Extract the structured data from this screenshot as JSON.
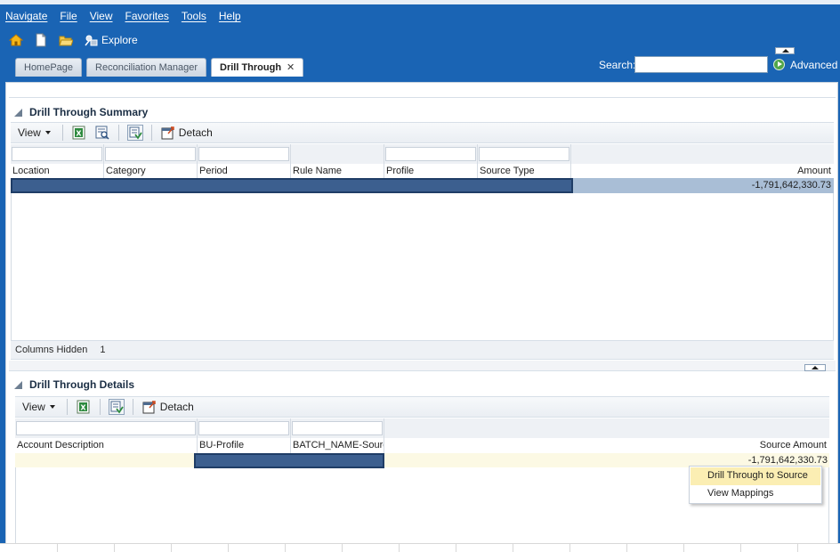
{
  "menu": [
    "Navigate",
    "File",
    "View",
    "Favorites",
    "Tools",
    "Help"
  ],
  "toolbar": {
    "icons": [
      "home-icon",
      "new-document-icon",
      "open-folder-icon",
      "explore-icon"
    ],
    "explore_label": "Explore"
  },
  "tabs": [
    {
      "label": "HomePage",
      "active": false
    },
    {
      "label": "Reconciliation Manager",
      "active": false
    },
    {
      "label": "Drill Through",
      "active": true,
      "close": "✕"
    }
  ],
  "search": {
    "label": "Search:",
    "value": "",
    "advanced_label": "Advanced"
  },
  "summary": {
    "title": "Drill Through Summary",
    "view_label": "View",
    "detach_label": "Detach",
    "columns": [
      "Location",
      "Category",
      "Period",
      "Rule Name",
      "Profile",
      "Source Type",
      "Amount"
    ],
    "row": {
      "amount": "-1,791,642,330.73"
    },
    "status_label": "Columns Hidden",
    "status_count": "1"
  },
  "details": {
    "title": "Drill Through Details",
    "view_label": "View",
    "detach_label": "Detach",
    "columns": [
      "Account Description",
      "BU-Profile",
      "BATCH_NAME-Source",
      "Source Amount"
    ],
    "row": {
      "amount": "-1,791,642,330.73"
    }
  },
  "context_menu": [
    "Drill Through to Source",
    "View Mappings"
  ],
  "colors": {
    "header_blue": "#1a64b4",
    "selected_row": "#a9bed6",
    "masked_cells": "#3c5f8f",
    "detail_row": "#fcf9e4",
    "menu_highlight": "#fbeeb3"
  }
}
